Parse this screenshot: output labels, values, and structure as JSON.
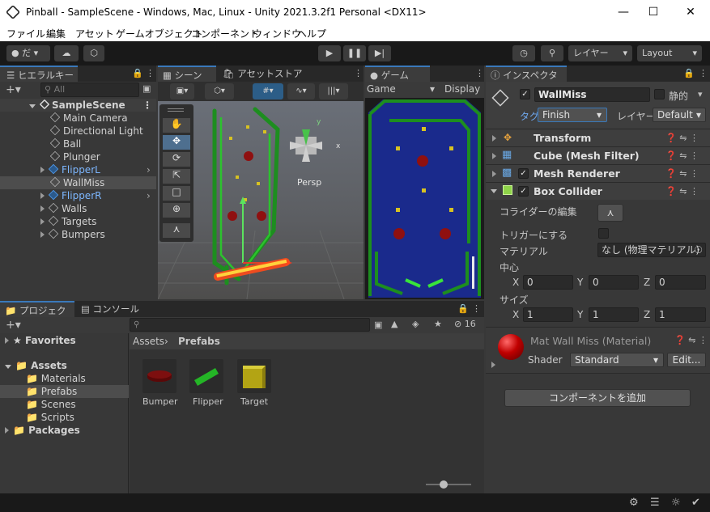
{
  "window": {
    "title": "Pinball - SampleScene - Windows, Mac, Linux - Unity 2021.3.2f1 Personal <DX11>"
  },
  "menu": [
    "ファイル",
    "編集",
    "アセット",
    "ゲームオブジェクト",
    "コンポーネント",
    "ウィンドウ",
    "ヘルプ"
  ],
  "toolbar": {
    "account": "だ",
    "layers": "レイヤー",
    "layout": "Layout"
  },
  "hierarchy": {
    "tab": "ヒエラルキー",
    "search_placeholder": "All",
    "scene": "SampleScene",
    "items": [
      {
        "label": "Main Camera"
      },
      {
        "label": "Directional Light"
      },
      {
        "label": "Ball"
      },
      {
        "label": "Plunger"
      },
      {
        "label": "FlipperL"
      },
      {
        "label": "WallMiss"
      },
      {
        "label": "FlipperR"
      },
      {
        "label": "Walls"
      },
      {
        "label": "Targets"
      },
      {
        "label": "Bumpers"
      }
    ]
  },
  "scene": {
    "tab": "シーン",
    "store_tab": "アセットストア",
    "persp": "Persp",
    "gizmo_y": "y",
    "gizmo_x": "x"
  },
  "game": {
    "tab": "ゲーム",
    "dropdown": "Game",
    "display": "Display"
  },
  "project": {
    "tab": "プロジェクト",
    "console_tab": "コンソール",
    "hidden_count": "16",
    "tree": {
      "favorites": "Favorites",
      "assets": "Assets",
      "materials": "Materials",
      "prefabs": "Prefabs",
      "scenes": "Scenes",
      "scripts": "Scripts",
      "packages": "Packages"
    },
    "breadcrumb": {
      "root": "Assets",
      "current": "Prefabs"
    },
    "assets": [
      {
        "label": "Bumper"
      },
      {
        "label": "Flipper"
      },
      {
        "label": "Target"
      }
    ]
  },
  "inspector": {
    "tab": "インスペクター",
    "object_name": "WallMiss",
    "static_label": "静的",
    "tag_label": "タグ",
    "tag_value": "Finish",
    "layer_label": "レイヤー",
    "layer_value": "Default",
    "components": {
      "transform": "Transform",
      "mesh_filter": "Cube (Mesh Filter)",
      "mesh_renderer": "Mesh Renderer",
      "box_collider": "Box Collider"
    },
    "collider": {
      "edit_label": "コライダーの編集",
      "trigger_label": "トリガーにする",
      "material_label": "マテリアル",
      "material_value": "なし (物理マテリアル)",
      "center_label": "中心",
      "size_label": "サイズ",
      "center": {
        "x": "0",
        "y": "0",
        "z": "0"
      },
      "size": {
        "x": "1",
        "y": "1",
        "z": "1"
      }
    },
    "material": {
      "name": "Mat Wall Miss (Material)",
      "shader_label": "Shader",
      "shader_value": "Standard",
      "edit": "Edit..."
    },
    "add_component": "コンポーネントを追加"
  },
  "colors": {
    "accent": "#3a79bb",
    "selection": "#2c5d87"
  }
}
